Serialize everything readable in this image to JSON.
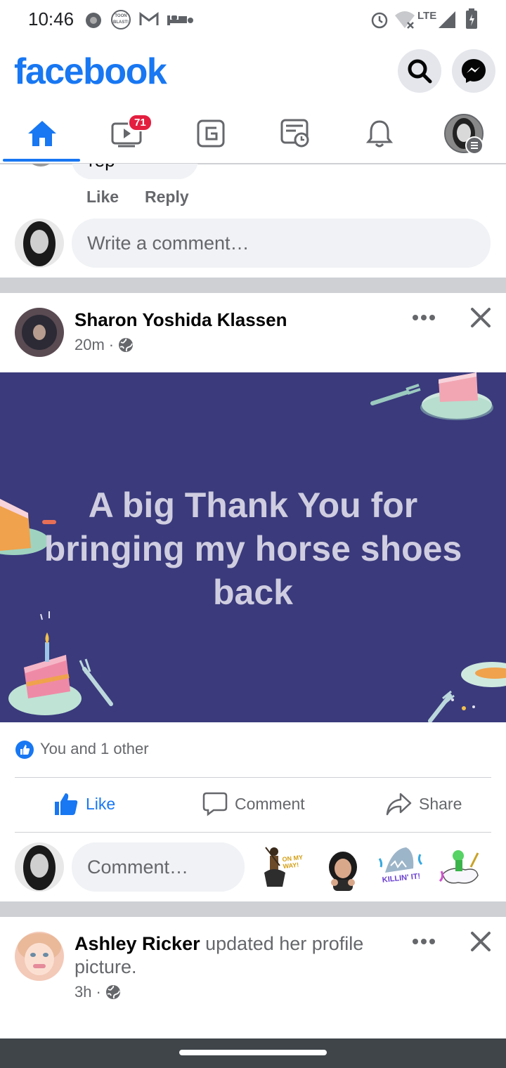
{
  "status_bar": {
    "time": "10:46",
    "app_icon_label": "TOON BLAST!",
    "network": "LTE"
  },
  "header": {
    "brand": "facebook",
    "search_icon": "search-icon",
    "messenger_icon": "messenger-icon"
  },
  "nav": {
    "tabs": [
      {
        "name": "home",
        "icon": "home-icon",
        "active": true
      },
      {
        "name": "watch",
        "icon": "video-icon",
        "badge": "71"
      },
      {
        "name": "gaming",
        "icon": "gaming-icon"
      },
      {
        "name": "news",
        "icon": "news-icon"
      },
      {
        "name": "notifications",
        "icon": "bell-icon"
      },
      {
        "name": "menu",
        "icon": "profile-menu-icon"
      }
    ]
  },
  "prev_comment": {
    "partial_text": "rep",
    "like": "Like",
    "reply": "Reply",
    "write_placeholder": "Write a comment…"
  },
  "post": {
    "author": "Sharon Yoshida Klassen",
    "time": "20m",
    "banner_text": "A big Thank You for bringing  my horse shoes back",
    "reactions": "You and 1 other",
    "actions": {
      "like": "Like",
      "comment": "Comment",
      "share": "Share"
    },
    "comment_placeholder": "Comment…",
    "stickers": [
      "ON MY WAY!",
      "",
      "KILLIN' IT!",
      ""
    ]
  },
  "next_post": {
    "author": "Ashley Ricker",
    "action_text": "updated her profile picture.",
    "time": "3h"
  },
  "colors": {
    "brand": "#1877f2",
    "banner_bg": "#3a3a7c",
    "badge": "#e41e3f"
  }
}
